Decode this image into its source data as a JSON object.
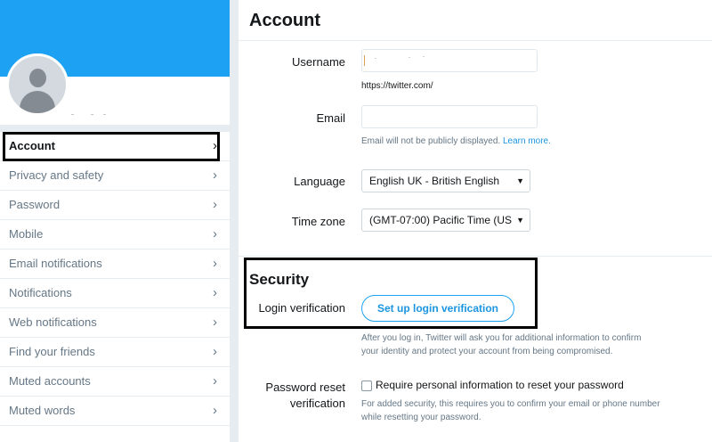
{
  "sidebar": {
    "items": [
      {
        "label": "Account",
        "active": true
      },
      {
        "label": "Privacy and safety"
      },
      {
        "label": "Password"
      },
      {
        "label": "Mobile"
      },
      {
        "label": "Email notifications"
      },
      {
        "label": "Notifications"
      },
      {
        "label": "Web notifications"
      },
      {
        "label": "Find your friends"
      },
      {
        "label": "Muted accounts"
      },
      {
        "label": "Muted words"
      }
    ],
    "chevron_icon": "chevron-right-icon",
    "banner_color": "#1da1f2"
  },
  "account": {
    "title": "Account",
    "username_label": "Username",
    "username_url": "https://twitter.com/",
    "email_label": "Email",
    "email_hint": "Email will not be publicly displayed.",
    "email_hint_link": "Learn more.",
    "language_label": "Language",
    "language_value": "English UK - British English",
    "timezone_label": "Time zone",
    "timezone_value": "(GMT-07:00) Pacific Time (US"
  },
  "security": {
    "title": "Security",
    "login_verification_label": "Login verification",
    "setup_button": "Set up login verification",
    "login_hint_line1": "After you log in, Twitter will ask you for additional information to confirm",
    "login_hint_line2": "your identity and protect your account from being compromised.",
    "reset_label_line1": "Password reset",
    "reset_label_line2": "verification",
    "reset_checkbox_label": "Require personal information to reset your password",
    "reset_hint_line1": "For added security, this requires you to confirm your email or phone number",
    "reset_hint_line2": "while resetting your password."
  },
  "colors": {
    "accent": "#1da1f2",
    "link": "#1b95e0",
    "highlight_border": "#000000"
  }
}
